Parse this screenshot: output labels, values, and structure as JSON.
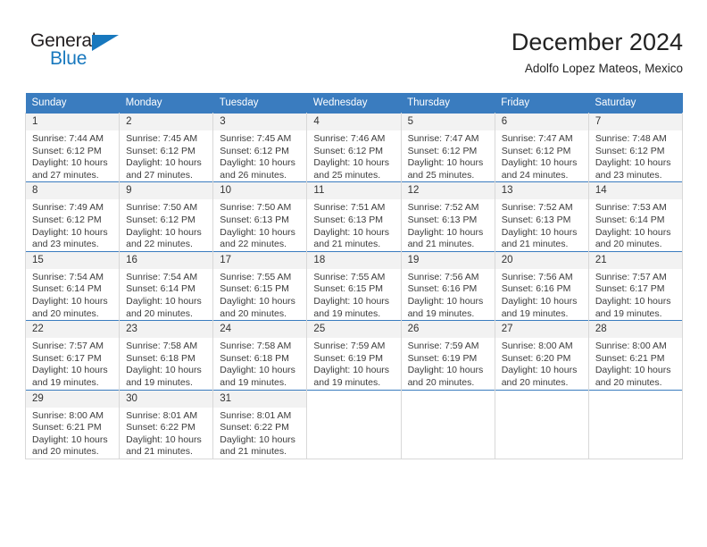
{
  "brand": {
    "name_part1": "General",
    "name_part2": "Blue",
    "triangle_color": "#1878be"
  },
  "header": {
    "title": "December 2024",
    "subtitle": "Adolfo Lopez Mateos, Mexico"
  },
  "theme": {
    "header_blue": "#3a7cbf",
    "daynum_band": "#f2f2f2",
    "grid_line": "#d8d8d8",
    "text": "#3c3c3c"
  },
  "weekdays": [
    "Sunday",
    "Monday",
    "Tuesday",
    "Wednesday",
    "Thursday",
    "Friday",
    "Saturday"
  ],
  "weeks": [
    [
      {
        "day": "1",
        "sunrise": "Sunrise: 7:44 AM",
        "sunset": "Sunset: 6:12 PM",
        "daylight1": "Daylight: 10 hours",
        "daylight2": "and 27 minutes."
      },
      {
        "day": "2",
        "sunrise": "Sunrise: 7:45 AM",
        "sunset": "Sunset: 6:12 PM",
        "daylight1": "Daylight: 10 hours",
        "daylight2": "and 27 minutes."
      },
      {
        "day": "3",
        "sunrise": "Sunrise: 7:45 AM",
        "sunset": "Sunset: 6:12 PM",
        "daylight1": "Daylight: 10 hours",
        "daylight2": "and 26 minutes."
      },
      {
        "day": "4",
        "sunrise": "Sunrise: 7:46 AM",
        "sunset": "Sunset: 6:12 PM",
        "daylight1": "Daylight: 10 hours",
        "daylight2": "and 25 minutes."
      },
      {
        "day": "5",
        "sunrise": "Sunrise: 7:47 AM",
        "sunset": "Sunset: 6:12 PM",
        "daylight1": "Daylight: 10 hours",
        "daylight2": "and 25 minutes."
      },
      {
        "day": "6",
        "sunrise": "Sunrise: 7:47 AM",
        "sunset": "Sunset: 6:12 PM",
        "daylight1": "Daylight: 10 hours",
        "daylight2": "and 24 minutes."
      },
      {
        "day": "7",
        "sunrise": "Sunrise: 7:48 AM",
        "sunset": "Sunset: 6:12 PM",
        "daylight1": "Daylight: 10 hours",
        "daylight2": "and 23 minutes."
      }
    ],
    [
      {
        "day": "8",
        "sunrise": "Sunrise: 7:49 AM",
        "sunset": "Sunset: 6:12 PM",
        "daylight1": "Daylight: 10 hours",
        "daylight2": "and 23 minutes."
      },
      {
        "day": "9",
        "sunrise": "Sunrise: 7:50 AM",
        "sunset": "Sunset: 6:12 PM",
        "daylight1": "Daylight: 10 hours",
        "daylight2": "and 22 minutes."
      },
      {
        "day": "10",
        "sunrise": "Sunrise: 7:50 AM",
        "sunset": "Sunset: 6:13 PM",
        "daylight1": "Daylight: 10 hours",
        "daylight2": "and 22 minutes."
      },
      {
        "day": "11",
        "sunrise": "Sunrise: 7:51 AM",
        "sunset": "Sunset: 6:13 PM",
        "daylight1": "Daylight: 10 hours",
        "daylight2": "and 21 minutes."
      },
      {
        "day": "12",
        "sunrise": "Sunrise: 7:52 AM",
        "sunset": "Sunset: 6:13 PM",
        "daylight1": "Daylight: 10 hours",
        "daylight2": "and 21 minutes."
      },
      {
        "day": "13",
        "sunrise": "Sunrise: 7:52 AM",
        "sunset": "Sunset: 6:13 PM",
        "daylight1": "Daylight: 10 hours",
        "daylight2": "and 21 minutes."
      },
      {
        "day": "14",
        "sunrise": "Sunrise: 7:53 AM",
        "sunset": "Sunset: 6:14 PM",
        "daylight1": "Daylight: 10 hours",
        "daylight2": "and 20 minutes."
      }
    ],
    [
      {
        "day": "15",
        "sunrise": "Sunrise: 7:54 AM",
        "sunset": "Sunset: 6:14 PM",
        "daylight1": "Daylight: 10 hours",
        "daylight2": "and 20 minutes."
      },
      {
        "day": "16",
        "sunrise": "Sunrise: 7:54 AM",
        "sunset": "Sunset: 6:14 PM",
        "daylight1": "Daylight: 10 hours",
        "daylight2": "and 20 minutes."
      },
      {
        "day": "17",
        "sunrise": "Sunrise: 7:55 AM",
        "sunset": "Sunset: 6:15 PM",
        "daylight1": "Daylight: 10 hours",
        "daylight2": "and 20 minutes."
      },
      {
        "day": "18",
        "sunrise": "Sunrise: 7:55 AM",
        "sunset": "Sunset: 6:15 PM",
        "daylight1": "Daylight: 10 hours",
        "daylight2": "and 19 minutes."
      },
      {
        "day": "19",
        "sunrise": "Sunrise: 7:56 AM",
        "sunset": "Sunset: 6:16 PM",
        "daylight1": "Daylight: 10 hours",
        "daylight2": "and 19 minutes."
      },
      {
        "day": "20",
        "sunrise": "Sunrise: 7:56 AM",
        "sunset": "Sunset: 6:16 PM",
        "daylight1": "Daylight: 10 hours",
        "daylight2": "and 19 minutes."
      },
      {
        "day": "21",
        "sunrise": "Sunrise: 7:57 AM",
        "sunset": "Sunset: 6:17 PM",
        "daylight1": "Daylight: 10 hours",
        "daylight2": "and 19 minutes."
      }
    ],
    [
      {
        "day": "22",
        "sunrise": "Sunrise: 7:57 AM",
        "sunset": "Sunset: 6:17 PM",
        "daylight1": "Daylight: 10 hours",
        "daylight2": "and 19 minutes."
      },
      {
        "day": "23",
        "sunrise": "Sunrise: 7:58 AM",
        "sunset": "Sunset: 6:18 PM",
        "daylight1": "Daylight: 10 hours",
        "daylight2": "and 19 minutes."
      },
      {
        "day": "24",
        "sunrise": "Sunrise: 7:58 AM",
        "sunset": "Sunset: 6:18 PM",
        "daylight1": "Daylight: 10 hours",
        "daylight2": "and 19 minutes."
      },
      {
        "day": "25",
        "sunrise": "Sunrise: 7:59 AM",
        "sunset": "Sunset: 6:19 PM",
        "daylight1": "Daylight: 10 hours",
        "daylight2": "and 19 minutes."
      },
      {
        "day": "26",
        "sunrise": "Sunrise: 7:59 AM",
        "sunset": "Sunset: 6:19 PM",
        "daylight1": "Daylight: 10 hours",
        "daylight2": "and 20 minutes."
      },
      {
        "day": "27",
        "sunrise": "Sunrise: 8:00 AM",
        "sunset": "Sunset: 6:20 PM",
        "daylight1": "Daylight: 10 hours",
        "daylight2": "and 20 minutes."
      },
      {
        "day": "28",
        "sunrise": "Sunrise: 8:00 AM",
        "sunset": "Sunset: 6:21 PM",
        "daylight1": "Daylight: 10 hours",
        "daylight2": "and 20 minutes."
      }
    ],
    [
      {
        "day": "29",
        "sunrise": "Sunrise: 8:00 AM",
        "sunset": "Sunset: 6:21 PM",
        "daylight1": "Daylight: 10 hours",
        "daylight2": "and 20 minutes."
      },
      {
        "day": "30",
        "sunrise": "Sunrise: 8:01 AM",
        "sunset": "Sunset: 6:22 PM",
        "daylight1": "Daylight: 10 hours",
        "daylight2": "and 21 minutes."
      },
      {
        "day": "31",
        "sunrise": "Sunrise: 8:01 AM",
        "sunset": "Sunset: 6:22 PM",
        "daylight1": "Daylight: 10 hours",
        "daylight2": "and 21 minutes."
      },
      null,
      null,
      null,
      null
    ]
  ]
}
